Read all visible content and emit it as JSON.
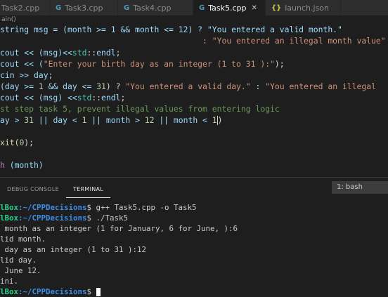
{
  "tabs": [
    {
      "label": "Task2.cpp",
      "icon": "c++-file-icon",
      "active": false
    },
    {
      "label": "Task3.cpp",
      "icon": "c++-file-icon",
      "active": false
    },
    {
      "label": "Task4.cpp",
      "icon": "c++-file-icon",
      "active": false
    },
    {
      "label": "Task5.cpp",
      "icon": "c++-file-icon",
      "active": true
    },
    {
      "label": "launch.json",
      "icon": "json-file-icon",
      "active": false
    }
  ],
  "breadcrumb": "ain()",
  "code": {
    "l1": "string msg = (month >= 1 && month <= 12) ? \"You entered a valid month.\"",
    "l2": "                                          : \"You entered an illegal month value\"",
    "l3_a": "cout << (msg)<<",
    "l3_b": "std",
    "l3_c": "::",
    "l3_d": "endl",
    "l3_e": ";",
    "l4_a": "cout << (",
    "l4_b": "\"Enter your birth day as an integer (1 to 31 ):\"",
    "l4_c": ");",
    "l5": "cin >> day;",
    "l6_a": "(day >= ",
    "l6_b": "1",
    "l6_c": " && day <= ",
    "l6_d": "31",
    "l6_e": ") ? ",
    "l6_f": "\"You entered a valid day.\"",
    "l6_g": " : ",
    "l6_h": "\"You entered an illegal",
    "l7_a": "cout << (msg) <<",
    "l7_b": "std",
    "l7_c": "::",
    "l7_d": "endl",
    "l7_e": ";",
    "l8": "st step task 5, prevent illegal values from entering logic",
    "l9_a": "ay > ",
    "l9_b": "31",
    "l9_c": " || day < ",
    "l9_d": "1",
    "l9_e": " || month > ",
    "l9_f": "12",
    "l9_g": " || month < ",
    "l9_h": "1",
    "l9_i": ")",
    "l10_a": "xit(",
    "l10_b": "0",
    "l10_c": ");",
    "l11_a": "h",
    "l11_b": " (month)"
  },
  "panel": {
    "tabs": [
      "DEBUG CONSOLE",
      "TERMINAL"
    ],
    "active_tab": "TERMINAL",
    "shell_select": "1: bash"
  },
  "terminal": {
    "prompt_host": "lBox",
    "prompt_path": ":~/CPPDecisions",
    "cmd1": "$ g++ Task5.cpp -o Task5",
    "cmd2": "$ ./Task5",
    "out1": " month as an integer (1 for January, 6 for June, ):6",
    "out2": "lid month.",
    "out3": " day as an integer (1 to 31 ):12",
    "out4": "lid day.",
    "out5": " June 12.",
    "out6": "ini.",
    "cmd3": "$ "
  },
  "colors": {
    "bg": "#1e1e1e",
    "tabbar": "#2d2d2d",
    "accent": "#569cd6",
    "prompt_host": "#23d18b",
    "prompt_path": "#3b8eea"
  }
}
